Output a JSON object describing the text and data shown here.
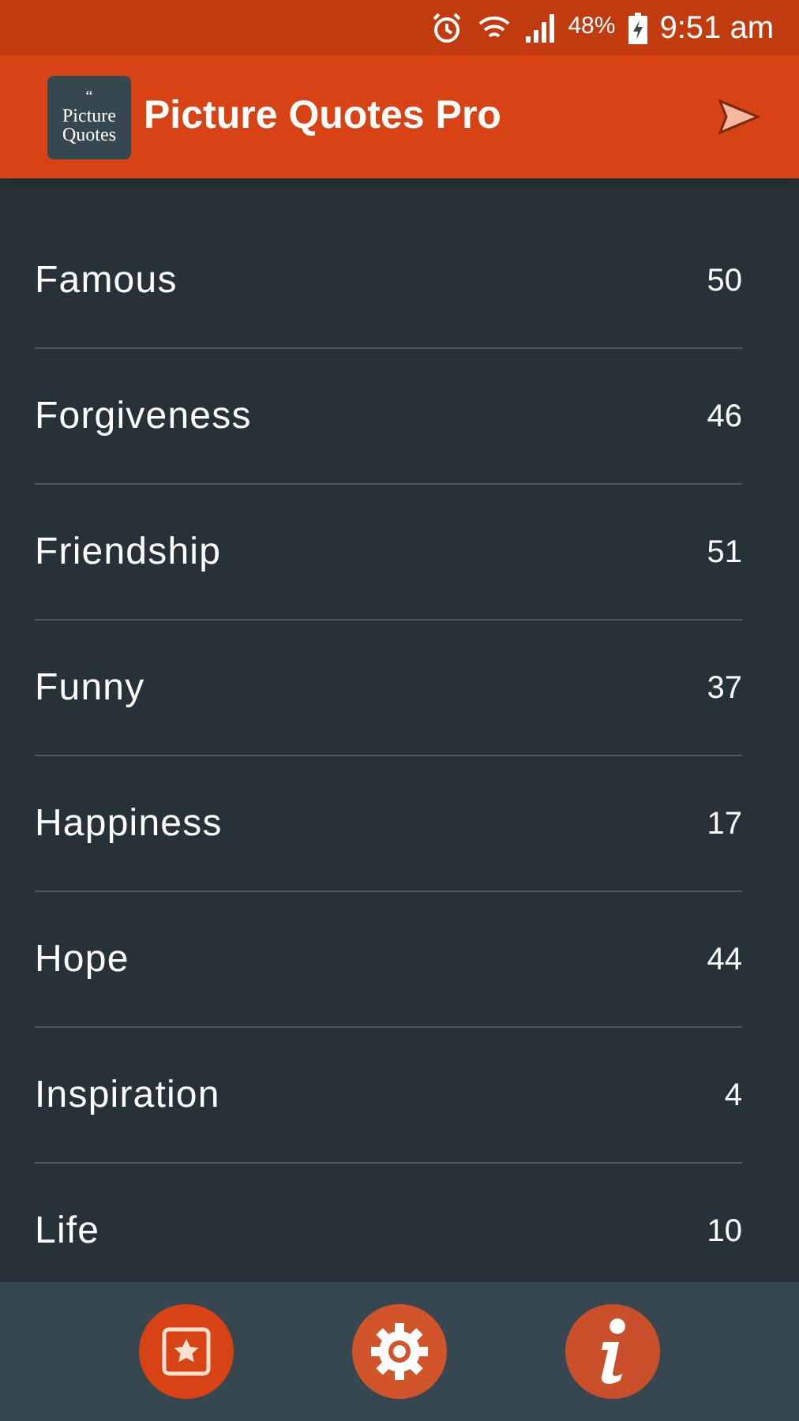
{
  "status_bar": {
    "battery": "48%",
    "time": "9:51 am"
  },
  "app_bar": {
    "logo": {
      "quote_mark": "“",
      "line_1": "Picture",
      "line_2": "Quotes"
    },
    "title": "Picture Quotes Pro"
  },
  "categories": [
    {
      "name": "Famous",
      "count": "50"
    },
    {
      "name": "Forgiveness",
      "count": "46"
    },
    {
      "name": "Friendship",
      "count": "51"
    },
    {
      "name": "Funny",
      "count": "37"
    },
    {
      "name": "Happiness",
      "count": "17"
    },
    {
      "name": "Hope",
      "count": "44"
    },
    {
      "name": "Inspiration",
      "count": "4"
    },
    {
      "name": "Life",
      "count": "10"
    }
  ]
}
